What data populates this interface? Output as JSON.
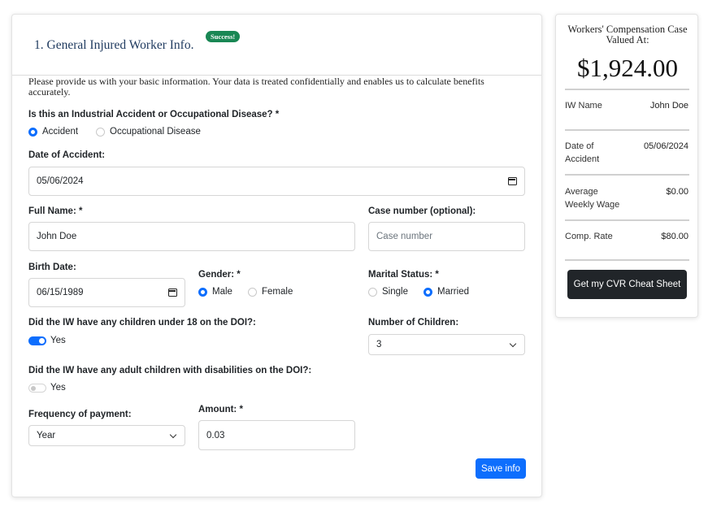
{
  "form": {
    "title": "1. General Injured Worker Info.",
    "badge": "Success!",
    "intro": "Please provide us with your basic information. Your data is treated confidentially and enables us to calculate benefits accurately.",
    "accident_type": {
      "label": "Is this an Industrial Accident or Occupational Disease? *",
      "options": [
        "Accident",
        "Occupational Disease"
      ],
      "selected": "Accident"
    },
    "date_of_accident": {
      "label": "Date of Accident:",
      "value": "05/06/2024"
    },
    "full_name": {
      "label": "Full Name: *",
      "value": "John Doe"
    },
    "case_number": {
      "label": "Case number (optional):",
      "placeholder": "Case number"
    },
    "birth_date": {
      "label": "Birth Date:",
      "value": "06/15/1989"
    },
    "gender": {
      "label": "Gender: *",
      "options": [
        "Male",
        "Female"
      ],
      "selected": "Male"
    },
    "marital_status": {
      "label": "Marital Status: *",
      "options": [
        "Single",
        "Married"
      ],
      "selected": "Married"
    },
    "children_under_18": {
      "label": "Did the IW have any children under 18 on the DOI?:",
      "toggle_label": "Yes",
      "checked": true
    },
    "number_of_children": {
      "label": "Number of Children:",
      "value": "3"
    },
    "adult_children_disabled": {
      "label": "Did the IW have any adult children with disabilities on the DOI?:",
      "toggle_label": "Yes",
      "checked": false
    },
    "frequency_of_payment": {
      "label": "Frequency of payment:",
      "value": "Year"
    },
    "amount": {
      "label": "Amount: *",
      "value": "0.03"
    },
    "save_label": "Save info"
  },
  "summary": {
    "title": "Workers' Compensation Case Valued At:",
    "amount": "$1,924.00",
    "rows": [
      {
        "label": "IW Name",
        "value": "John Doe"
      },
      {
        "label": "Date of Accident",
        "value": "05/06/2024"
      },
      {
        "label": "Average Weekly Wage",
        "value": "$0.00"
      },
      {
        "label": "Comp. Rate",
        "value": "$80.00"
      }
    ],
    "cta_label": "Get my CVR Cheat Sheet"
  },
  "colors": {
    "primary": "#0d6efd",
    "success": "#198754",
    "dark": "#212529",
    "title": "#1f3a5f"
  }
}
